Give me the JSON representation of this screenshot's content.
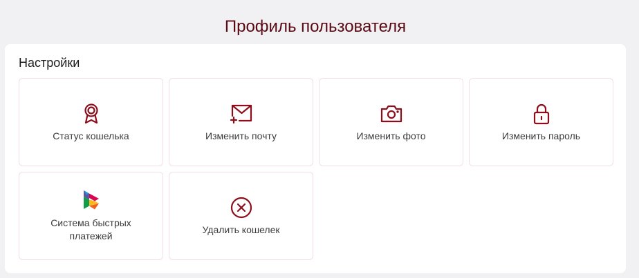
{
  "page": {
    "title": "Профиль пользователя"
  },
  "settings": {
    "title": "Настройки",
    "items": [
      {
        "label": "Статус кошелька",
        "icon": "medal-icon"
      },
      {
        "label": "Изменить почту",
        "icon": "envelope-plus-icon"
      },
      {
        "label": "Изменить фото",
        "icon": "camera-icon"
      },
      {
        "label": "Изменить пароль",
        "icon": "lock-icon"
      },
      {
        "label": "Система быстрых платежей",
        "icon": "sbp-logo-icon"
      },
      {
        "label": "Удалить кошелек",
        "icon": "close-circle-icon"
      }
    ]
  },
  "colors": {
    "accent": "#8b0e1a",
    "title": "#5a0a14",
    "background": "#f1f1f3",
    "tile_border": "#f3dfe2"
  }
}
